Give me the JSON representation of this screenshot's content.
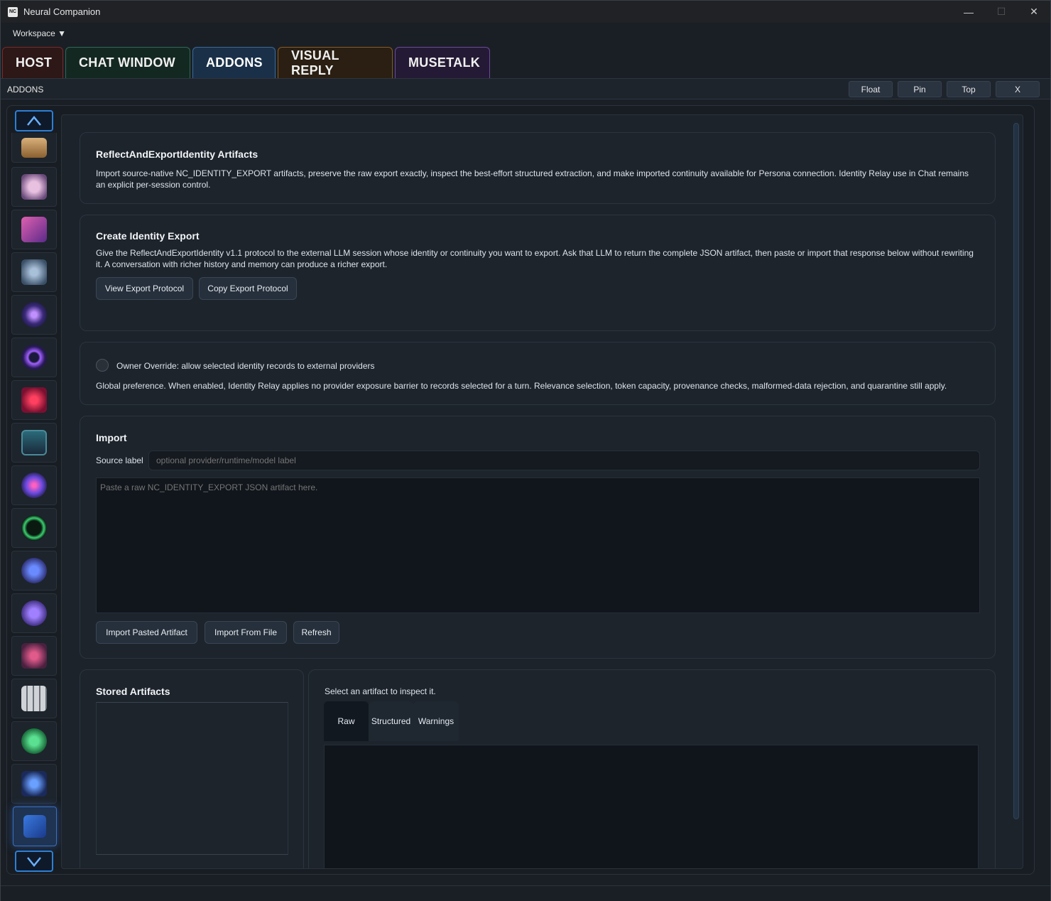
{
  "window": {
    "logo_text": "NC",
    "title": "Neural Companion",
    "minimize": "—",
    "maximize": "☐",
    "close": "✕"
  },
  "menu": {
    "workspace": "Workspace ▼"
  },
  "tabs": [
    {
      "label": "HOST"
    },
    {
      "label": "CHAT WINDOW"
    },
    {
      "label": "ADDONS"
    },
    {
      "label": "VISUAL REPLY"
    },
    {
      "label": "MUSETALK"
    }
  ],
  "subheader": {
    "title": "ADDONS",
    "float": "Float",
    "pin": "Pin",
    "top": "Top",
    "close": "X"
  },
  "sidebar": {
    "items": [
      {
        "icon": "book-icon",
        "color": "#c9a06a"
      },
      {
        "icon": "mask-face-icon",
        "color": "#d4a0c8"
      },
      {
        "icon": "presentation-icon",
        "color": "#b06ad0"
      },
      {
        "icon": "microphone-icon",
        "color": "#7a9ab8"
      },
      {
        "icon": "crosshair-orb-icon",
        "color": "#8a5ad8"
      },
      {
        "icon": "ring-orb-icon",
        "color": "#9a5ae0"
      },
      {
        "icon": "alien-face-icon",
        "color": "#d0304a"
      },
      {
        "icon": "monitor-chart-icon",
        "color": "#3aa0a8"
      },
      {
        "icon": "neon-brain-icon",
        "color": "#7a5ae0"
      },
      {
        "icon": "pulse-circle-icon",
        "color": "#3ad070"
      },
      {
        "icon": "chat-bubbles-icon",
        "color": "#5a7ae0"
      },
      {
        "icon": "discord-icon",
        "color": "#8a6ae0"
      },
      {
        "icon": "polygon-net-icon",
        "color": "#c04a7a"
      },
      {
        "icon": "keyboard-icon",
        "color": "#c8ccd0"
      },
      {
        "icon": "play-chat-icon",
        "color": "#3ac070"
      },
      {
        "icon": "robot-headset-icon",
        "color": "#4a7ad0"
      },
      {
        "icon": "cursor-window-icon",
        "color": "#4a8ae0"
      }
    ]
  },
  "artifacts_card": {
    "title": "ReflectAndExportIdentity Artifacts",
    "description": "Import source-native NC_IDENTITY_EXPORT artifacts, preserve the raw export exactly, inspect the best-effort structured extraction, and make imported continuity available for Persona connection. Identity Relay use in Chat remains an explicit per-session control."
  },
  "create_card": {
    "title": "Create Identity Export",
    "description": "Give the ReflectAndExportIdentity v1.1 protocol to the external LLM session whose identity or continuity you want to export. Ask that LLM to return the complete JSON artifact, then paste or import that response below without rewriting it. A conversation with richer history and memory can produce a richer export.",
    "view_button": "View Export Protocol",
    "copy_button": "Copy Export Protocol"
  },
  "override_card": {
    "label": "Owner Override: allow selected identity records to external providers",
    "description": "Global preference. When enabled, Identity Relay applies no provider exposure barrier to records selected for a turn. Relevance selection, token capacity, provenance checks, malformed-data rejection, and quarantine still apply."
  },
  "import_card": {
    "title": "Import",
    "source_label": "Source label",
    "source_placeholder": "optional provider/runtime/model label",
    "json_placeholder": "Paste a raw NC_IDENTITY_EXPORT JSON artifact here.",
    "import_pasted": "Import Pasted Artifact",
    "import_file": "Import From File",
    "refresh": "Refresh"
  },
  "stored_card": {
    "title": "Stored Artifacts"
  },
  "inspect_card": {
    "hint": "Select an artifact to inspect it.",
    "tabs": [
      "Raw",
      "Structured",
      "Warnings"
    ]
  }
}
